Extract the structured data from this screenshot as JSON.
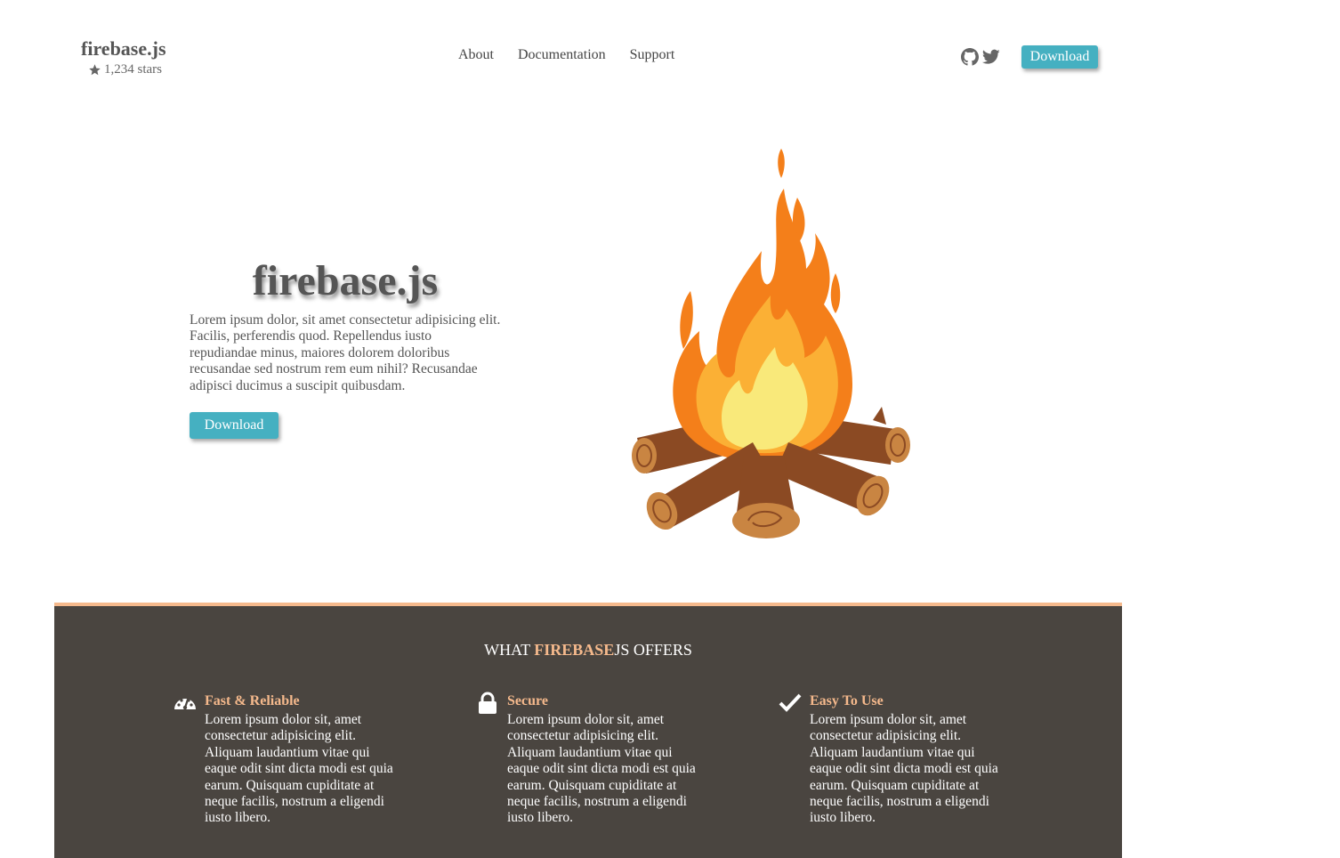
{
  "brand": {
    "name": "firebase.js",
    "stars": "1,234 stars"
  },
  "nav": {
    "links": [
      "About",
      "Documentation",
      "Support"
    ],
    "download_label": "Download",
    "icons": [
      "github-icon",
      "twitter-icon"
    ]
  },
  "hero": {
    "title": "firebase.js",
    "text": "Lorem ipsum dolor, sit amet consectetur adipisicing elit. Facilis, perferendis quod. Repellendus iusto repudiandae minus, maiores dolorem doloribus recusandae sed nostrum rem eum nihil? Recusandae adipisci ducimus a suscipit quibusdam.",
    "download_label": "Download",
    "image": "campfire-illustration"
  },
  "features": {
    "title_prefix": "WHAT ",
    "title_accent": "FIREBASE",
    "title_suffix": "JS OFFERS",
    "items": [
      {
        "icon": "speedometer-icon",
        "title": "Fast & Reliable",
        "text": "Lorem ipsum dolor sit, amet consectetur adipisicing elit. Aliquam laudantium vitae qui eaque odit sint dicta modi est quia earum. Quisquam cupiditate at neque facilis, nostrum a eligendi iusto libero."
      },
      {
        "icon": "lock-icon",
        "title": "Secure",
        "text": "Lorem ipsum dolor sit, amet consectetur adipisicing elit. Aliquam laudantium vitae qui eaque odit sint dicta modi est quia earum. Quisquam cupiditate at neque facilis, nostrum a eligendi iusto libero."
      },
      {
        "icon": "checkmark-icon",
        "title": "Easy To Use",
        "text": "Lorem ipsum dolor sit, amet consectetur adipisicing elit. Aliquam laudantium vitae qui eaque odit sint dicta modi est quia earum. Quisquam cupiditate at neque facilis, nostrum a eligendi iusto libero."
      }
    ]
  },
  "colors": {
    "accent": "#45b0c1",
    "features_bg": "#4a4540",
    "features_accent": "#f5b98c"
  }
}
